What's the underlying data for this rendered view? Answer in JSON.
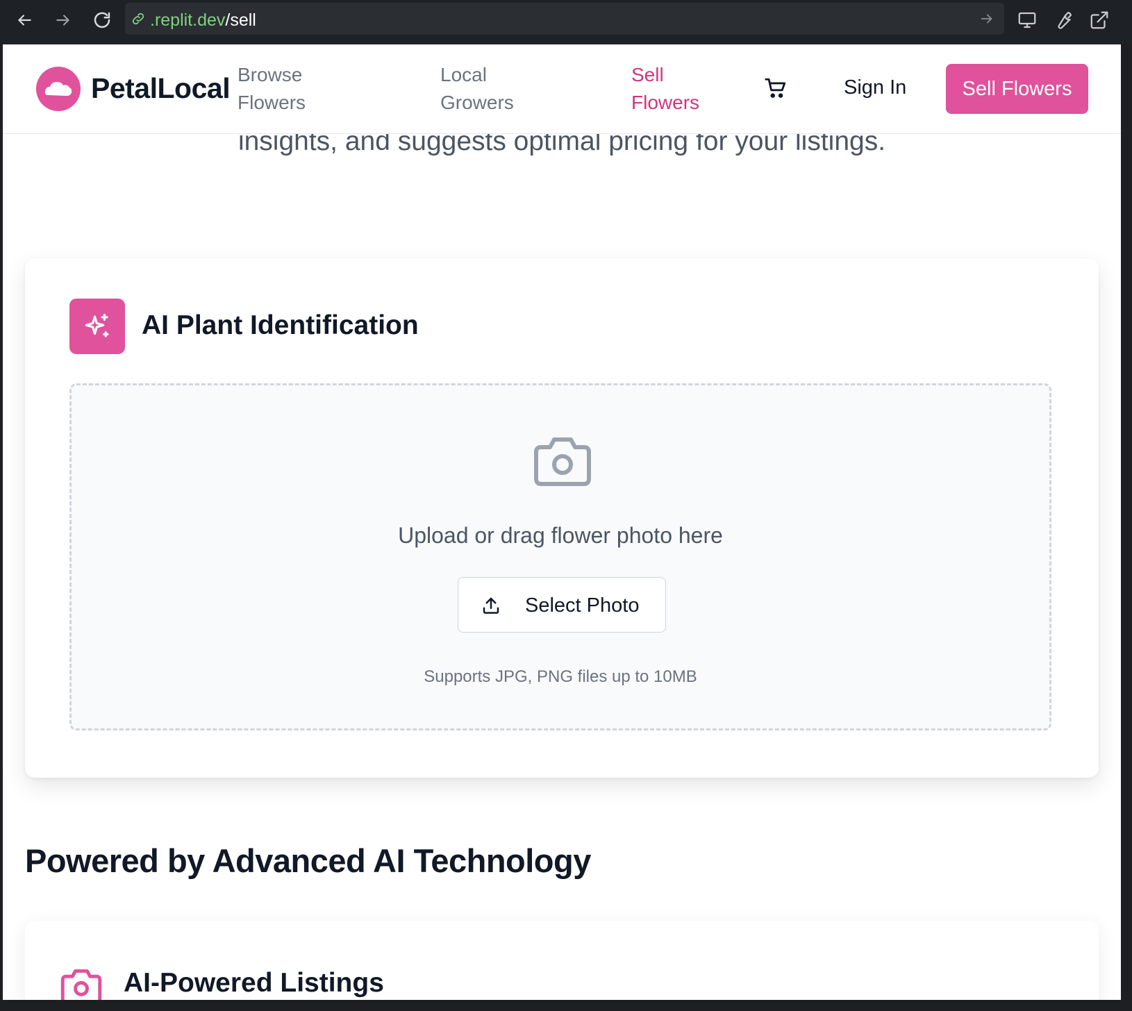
{
  "browser": {
    "url_host": ".replit.dev",
    "url_path": "/sell"
  },
  "header": {
    "brand": "PetalLocal",
    "nav": [
      {
        "line1": "Browse",
        "line2": "Flowers",
        "active": false
      },
      {
        "line1": "Local",
        "line2": "Growers",
        "active": false
      },
      {
        "line1": "Sell",
        "line2": "Flowers",
        "active": true
      }
    ],
    "sign_in": "Sign In",
    "sell_button": "Sell Flowers"
  },
  "hero": {
    "tail_text": "insights, and suggests optimal pricing for your listings."
  },
  "ai_card": {
    "title": "AI Plant Identification",
    "upload_prompt": "Upload or drag flower photo here",
    "select_button": "Select Photo",
    "support_note": "Supports JPG, PNG files up to 10MB"
  },
  "powered": {
    "heading": "Powered by Advanced AI Technology",
    "features": [
      {
        "title": "AI-Powered Listings",
        "icon": "camera-icon"
      }
    ]
  },
  "colors": {
    "brand_pink": "#e0529b",
    "active_nav": "#d3347d",
    "chrome_bg": "#1e2126"
  }
}
